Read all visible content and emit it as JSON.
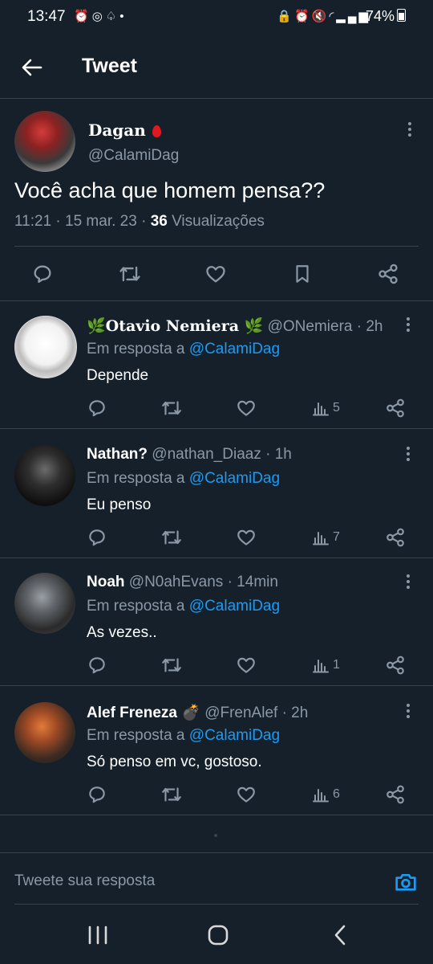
{
  "status_bar": {
    "time": "13:47",
    "battery": "74%",
    "icons_left": [
      "alarm-icon",
      "instagram-icon",
      "snapchat-icon",
      "dot-icon"
    ],
    "icons_right": [
      "lock-icon",
      "alarm-icon",
      "mute-icon",
      "wifi-icon",
      "signal-icon"
    ]
  },
  "header": {
    "title": "Tweet"
  },
  "main_tweet": {
    "name": "Dagan",
    "handle": "@CalamiDag",
    "text": "Você acha que homem pensa??",
    "time": "11:21 · 15 mar. 23 · ",
    "views_count": "36",
    "views_label": " Visualizações"
  },
  "replies": [
    {
      "name": "🌿Otavio Nemiera 🌿",
      "handle": "@ONemiera · 2h",
      "reply_to_label": "Em resposta a ",
      "reply_to_mention": "@CalamiDag",
      "text": "Depende",
      "views": "5"
    },
    {
      "name": "Nathan?",
      "handle": "@nathan_Diaaz · 1h",
      "reply_to_label": "Em resposta a ",
      "reply_to_mention": "@CalamiDag",
      "text": "Eu penso",
      "views": "7"
    },
    {
      "name": "Noah",
      "handle": "@N0ahEvans · 14min",
      "reply_to_label": "Em resposta a ",
      "reply_to_mention": "@CalamiDag",
      "text": "As vezes..",
      "views": "1"
    },
    {
      "name": "Alef Freneza 💣",
      "handle": "@FrenAlef · 2h",
      "reply_to_label": "Em resposta a ",
      "reply_to_mention": "@CalamiDag",
      "text": "Só penso em vc, gostoso.",
      "views": "6"
    }
  ],
  "composer": {
    "placeholder": "Tweete sua resposta"
  },
  "colors": {
    "background": "#15202b",
    "divider": "#38444d",
    "muted": "#8b98a5",
    "accent": "#1d9bf0"
  }
}
